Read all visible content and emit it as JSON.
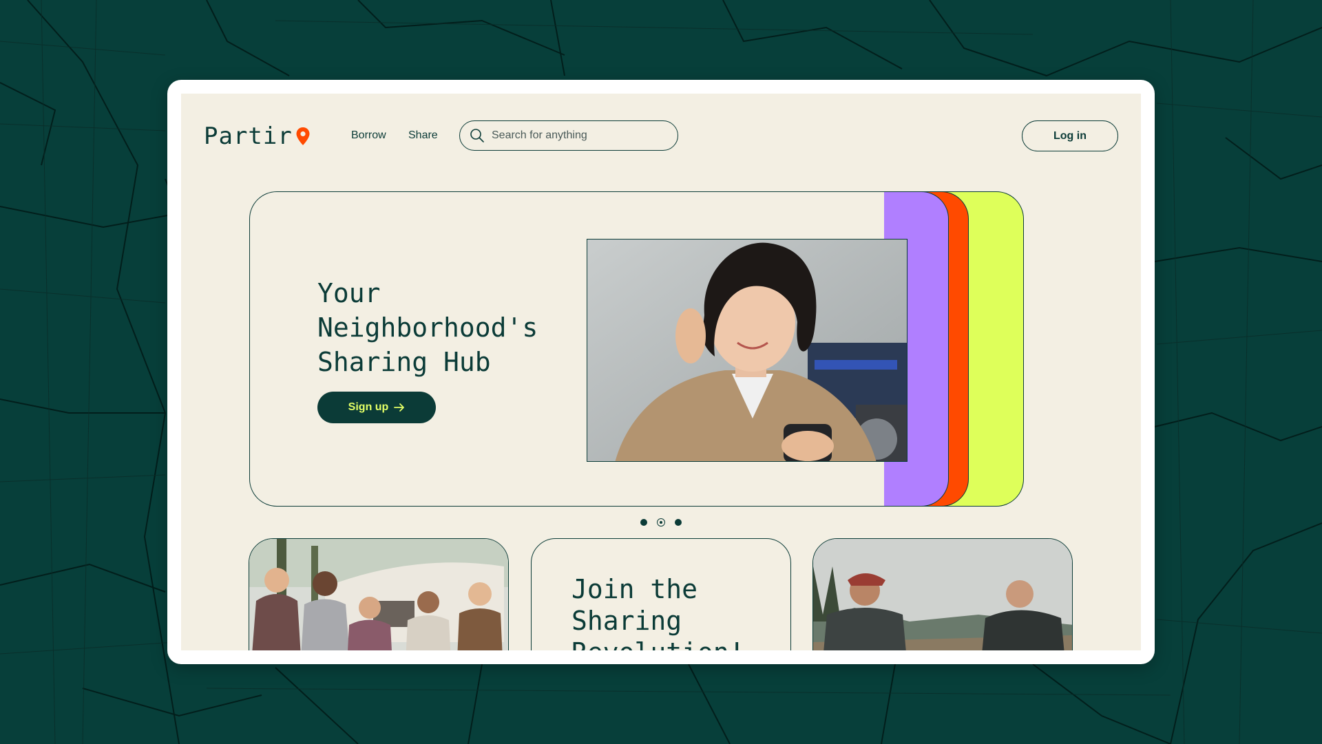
{
  "brand": {
    "name": "Partir",
    "pin_color": "#ff4a00"
  },
  "nav": {
    "borrow": "Borrow",
    "share": "Share"
  },
  "search": {
    "placeholder": "Search for anything",
    "value": ""
  },
  "header": {
    "login_label": "Log in"
  },
  "hero": {
    "title": "Your Neighborhood's Sharing Hub",
    "signup_label": "Sign up",
    "stack_colors": [
      "#b07fff",
      "#ff4a00",
      "#deff5a"
    ]
  },
  "carousel": {
    "dot_count": 3,
    "active_index": 1
  },
  "cards": {
    "join_title": "Join the Sharing Revolution!"
  },
  "colors": {
    "background": "#073f3a",
    "page": "#f3efe3",
    "primary": "#0b3b37",
    "accent_lime": "#e3ff66"
  }
}
